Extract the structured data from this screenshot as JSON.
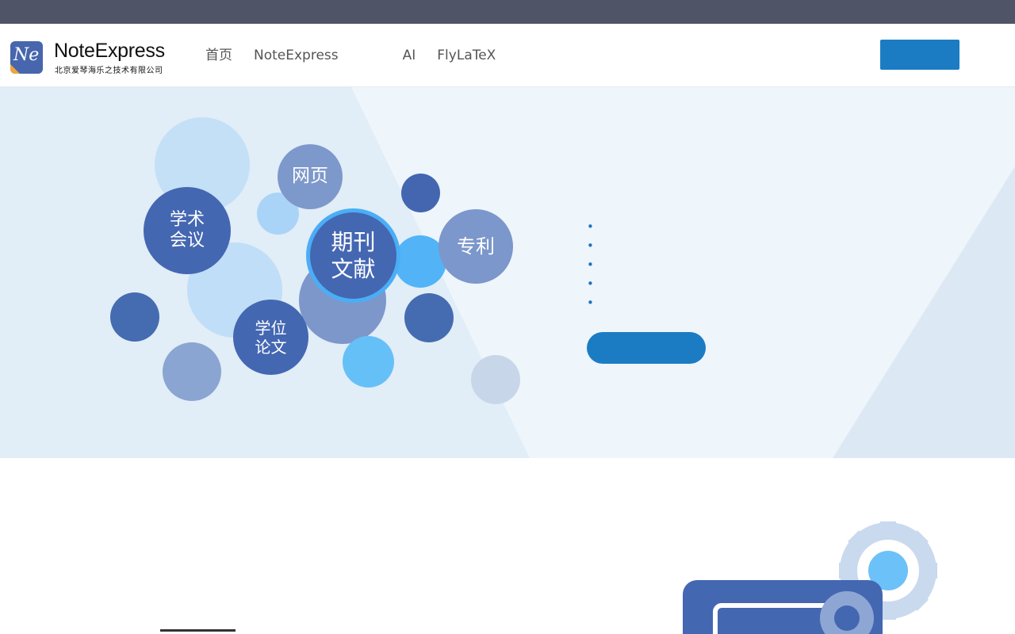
{
  "topbar": {
    "link": ""
  },
  "logo": {
    "name": "NoteExpress",
    "subtitle": "北京爱琴海乐之技术有限公司",
    "mark": "Ne"
  },
  "nav": [
    {
      "label": "首页"
    },
    {
      "label": "NoteExpress"
    },
    {
      "label": ""
    },
    {
      "label": ""
    },
    {
      "label": "AI"
    },
    {
      "label": "FlyLaTeX"
    },
    {
      "label": "",
      "active": true
    },
    {
      "label": ""
    },
    {
      "label": ""
    }
  ],
  "header": {
    "login": "",
    "register": ""
  },
  "hero": {
    "bubbles": {
      "web": "网页",
      "conference": "学术会议",
      "journal": "期刊文献",
      "patent": "专利",
      "thesis": "学位论文"
    },
    "title": "",
    "list": [
      "",
      "",
      "",
      "",
      ""
    ],
    "cta": "",
    "note_pre": "",
    "note_red": "",
    "note_post": ""
  },
  "section": {
    "title_left": "",
    "title_right": ""
  },
  "colors": {
    "brand": "#1b7cc4",
    "accent_red": "#e0111c",
    "topbar": "#4f5566",
    "hero_bg": "#e1edf7"
  }
}
